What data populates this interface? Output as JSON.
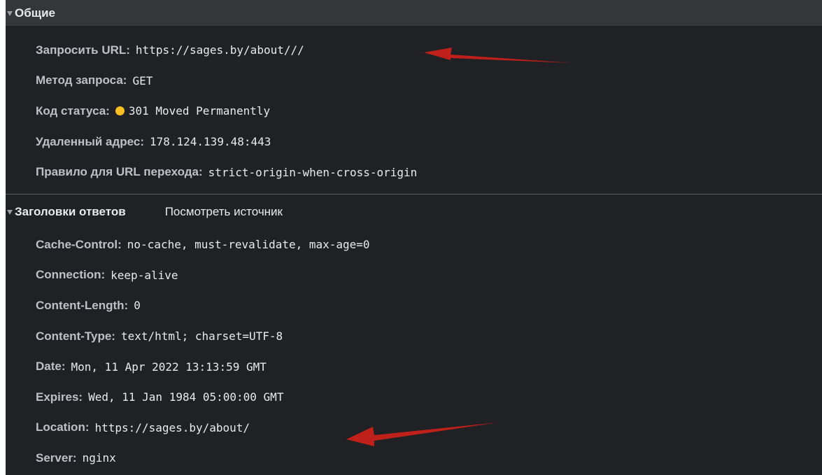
{
  "general": {
    "title": "Общие",
    "rows": [
      {
        "key": "Запросить URL:",
        "value": "https://sages.by/about///"
      },
      {
        "key": "Метод запроса:",
        "value": "GET"
      },
      {
        "key": "Код статуса:",
        "value": "301 Moved Permanently"
      },
      {
        "key": "Удаленный адрес:",
        "value": "178.124.139.48:443"
      },
      {
        "key": "Правило для URL перехода:",
        "value": "strict-origin-when-cross-origin"
      }
    ],
    "status_color": "#fbbf24"
  },
  "response_headers": {
    "title": "Заголовки ответов",
    "view_source_label": "Посмотреть источник",
    "rows": [
      {
        "key": "Cache-Control:",
        "value": "no-cache, must-revalidate, max-age=0"
      },
      {
        "key": "Connection:",
        "value": "keep-alive"
      },
      {
        "key": "Content-Length:",
        "value": "0"
      },
      {
        "key": "Content-Type:",
        "value": "text/html; charset=UTF-8"
      },
      {
        "key": "Date:",
        "value": "Mon, 11 Apr 2022 13:13:59 GMT"
      },
      {
        "key": "Expires:",
        "value": "Wed, 11 Jan 1984 05:00:00 GMT"
      },
      {
        "key": "Location:",
        "value": "https://sages.by/about/"
      },
      {
        "key": "Server:",
        "value": "nginx"
      }
    ]
  },
  "annotation_color": "#c0201a"
}
